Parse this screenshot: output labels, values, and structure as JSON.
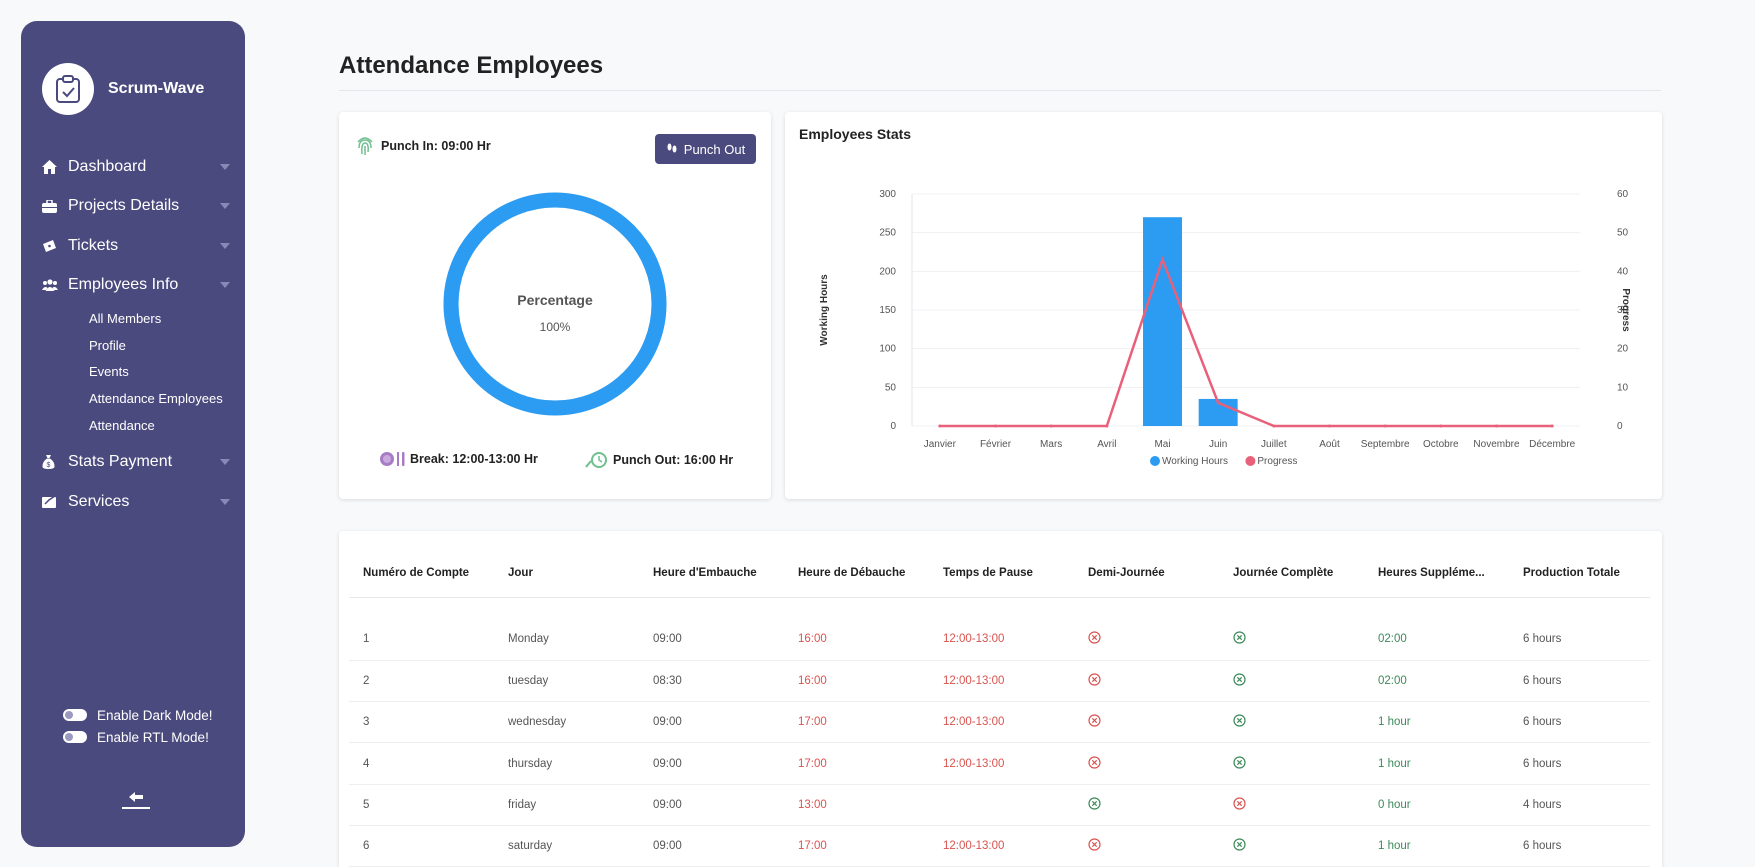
{
  "brand": {
    "name": "Scrum-Wave"
  },
  "sidebar": {
    "items": [
      {
        "label": "Dashboard",
        "icon": "home-icon"
      },
      {
        "label": "Projects Details",
        "icon": "briefcase-icon"
      },
      {
        "label": "Tickets",
        "icon": "ticket-icon"
      },
      {
        "label": "Employees Info",
        "icon": "users-icon"
      }
    ],
    "subitems": [
      "All Members",
      "Profile",
      "Events",
      "Attendance Employees",
      "Attendance"
    ],
    "items_after": [
      {
        "label": "Stats Payment",
        "icon": "money-bag-icon"
      },
      {
        "label": "Services",
        "icon": "services-icon"
      }
    ],
    "dark_mode_label": "Enable Dark Mode!",
    "rtl_mode_label": "Enable RTL Mode!"
  },
  "page": {
    "title": "Attendance Employees"
  },
  "punch": {
    "punch_in": "Punch In: 09:00 Hr",
    "punch_out_button": "Punch Out",
    "ring_title": "Percentage",
    "ring_value": "100%",
    "ring_percent": 100,
    "break": "Break: 12:00-13:00 Hr",
    "punch_out_time": "Punch Out: 16:00 Hr"
  },
  "stats": {
    "title": "Employees Stats"
  },
  "chart_data": {
    "type": "bar",
    "categories": [
      "Janvier",
      "Février",
      "Mars",
      "Avril",
      "Mai",
      "Juin",
      "Juillet",
      "Août",
      "Septembre",
      "Octobre",
      "Novembre",
      "Décembre"
    ],
    "series": [
      {
        "name": "Working Hours",
        "type": "bar",
        "axis": "left",
        "color": "#2b9cf2",
        "values": [
          0,
          0,
          0,
          0,
          270,
          35,
          0,
          0,
          0,
          0,
          0,
          0
        ]
      },
      {
        "name": "Progress",
        "type": "line",
        "axis": "right",
        "color": "#e8607a",
        "values": [
          0,
          0,
          0,
          0,
          43,
          6,
          0,
          0,
          0,
          0,
          0,
          0
        ]
      }
    ],
    "ylabel": "Working Hours",
    "y2label": "Progress",
    "ylim": [
      0,
      300
    ],
    "y2lim": [
      0,
      60
    ],
    "yticks": [
      "0",
      "50",
      "100",
      "150",
      "200",
      "250",
      "300"
    ],
    "y2ticks": [
      "0",
      "10",
      "20",
      "30",
      "40",
      "50",
      "60"
    ],
    "legend": "bottom",
    "grid": true
  },
  "table": {
    "headers": [
      "Numéro de Compte",
      "Jour",
      "Heure d'Embauche",
      "Heure de Débauche",
      "Temps de Pause",
      "Demi-Journée",
      "Journée Complète",
      "Heures Suppléme...",
      "Production Totale"
    ],
    "rows": [
      {
        "num": "1",
        "day": "Monday",
        "in": "09:00",
        "out": "16:00",
        "pause": "12:00-13:00",
        "half": "no",
        "full": "yes",
        "extra": "02:00",
        "total": "6 hours"
      },
      {
        "num": "2",
        "day": "tuesday",
        "in": "08:30",
        "out": "16:00",
        "pause": "12:00-13:00",
        "half": "no",
        "full": "yes",
        "extra": "02:00",
        "total": "6 hours"
      },
      {
        "num": "3",
        "day": "wednesday",
        "in": "09:00",
        "out": "17:00",
        "pause": "12:00-13:00",
        "half": "no",
        "full": "yes",
        "extra": "1 hour",
        "total": "6 hours"
      },
      {
        "num": "4",
        "day": "thursday",
        "in": "09:00",
        "out": "17:00",
        "pause": "12:00-13:00",
        "half": "no",
        "full": "yes",
        "extra": "1 hour",
        "total": "6 hours"
      },
      {
        "num": "5",
        "day": "friday",
        "in": "09:00",
        "out": "13:00",
        "pause": "",
        "half": "yes",
        "full": "no",
        "extra": "0 hour",
        "total": "4 hours"
      },
      {
        "num": "6",
        "day": "saturday",
        "in": "09:00",
        "out": "17:00",
        "pause": "12:00-13:00",
        "half": "no",
        "full": "yes",
        "extra": "1 hour",
        "total": "6 hours"
      }
    ]
  }
}
